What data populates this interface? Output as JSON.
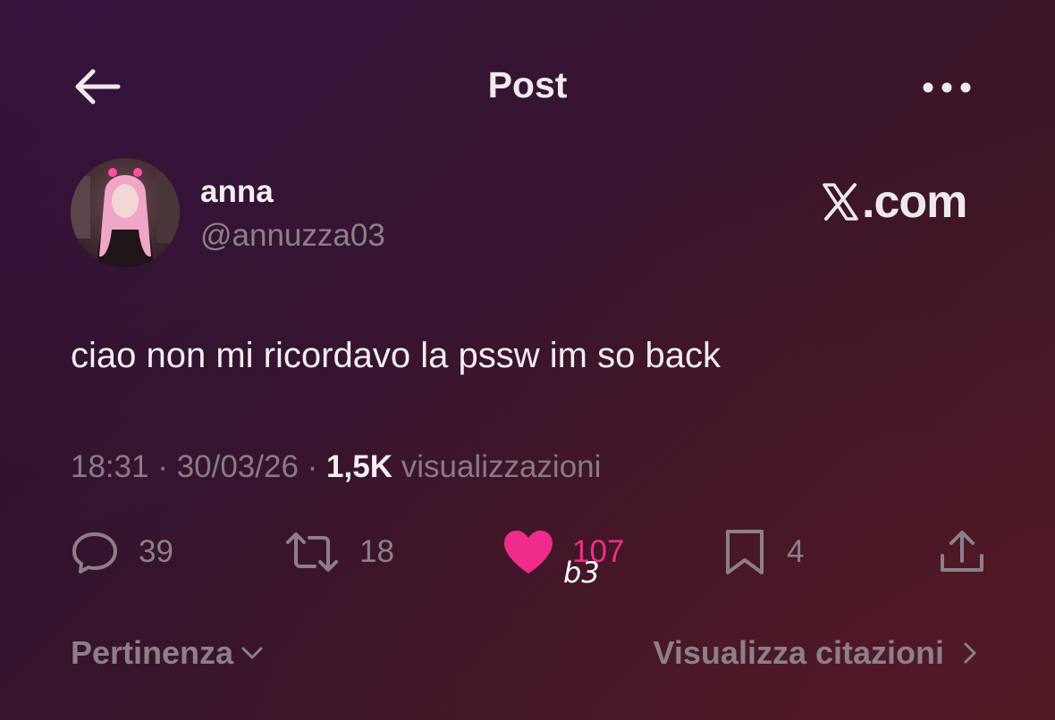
{
  "header": {
    "title": "Post"
  },
  "author": {
    "name": "anna",
    "handle": "@annuzza03"
  },
  "brand": {
    "label": ".com"
  },
  "post": {
    "text": "ciao non mi ricordavo la pssw im so back"
  },
  "meta": {
    "time": "18:31 · 30/03/26 · ",
    "views_count": "1,5K",
    "views_label": " visualizzazioni"
  },
  "actions": {
    "replies": "39",
    "reposts": "18",
    "likes": "107",
    "bookmarks": "4"
  },
  "overlay": {
    "text": "b3"
  },
  "footer": {
    "sort_label": "Pertinenza",
    "quotes_label": "Visualizza citazioni"
  },
  "colors": {
    "like": "#f02c8a",
    "muted": "#8d7f8a",
    "text": "#f4edf1"
  }
}
